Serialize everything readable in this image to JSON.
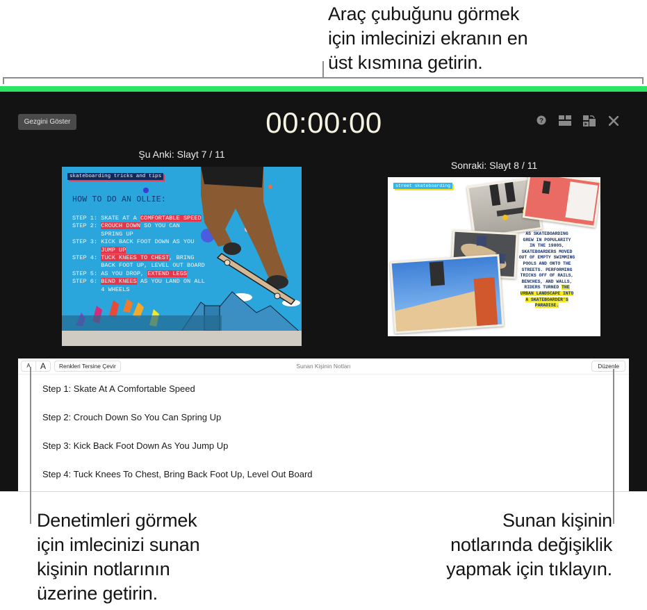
{
  "callouts": {
    "top": "Araç çubuğunu görmek\niçin imlecinizi ekranın en\nüst kısmına getirin.",
    "left": "Denetimleri görmek\niçin imlecinizi sunan\nkişinin notlarının\nüzerine getirin.",
    "right": "Sunan kişinin\nnotlarında değişiklik\nyapmak için tıklayın."
  },
  "presenter": {
    "accent_color": "#2ce564",
    "show_navigator_label": "Gezgini Göster",
    "timer": "00:00:00",
    "toolbar_icons": [
      "help-icon",
      "layout-icon",
      "swap-displays-icon",
      "close-icon"
    ],
    "current_label": "Şu Anki: Slayt 7 / 11",
    "next_label": "Sonraki: Slayt 8 / 11"
  },
  "current_slide": {
    "title": "skateboarding tricks and tips",
    "heading": "HOW TO DO AN OLLIE:",
    "steps": [
      {
        "prefix": "STEP 1: ",
        "parts": [
          {
            "t": "SKATE AT A ",
            "hl": false
          },
          {
            "t": "COMFORTABLE SPEED",
            "hl": true
          }
        ]
      },
      {
        "prefix": "STEP 2: ",
        "parts": [
          {
            "t": "CROUCH DOWN",
            "hl": true
          },
          {
            "t": " SO YOU CAN",
            "hl": false
          }
        ]
      },
      {
        "prefix": "        ",
        "parts": [
          {
            "t": "SPRING UP",
            "hl": false
          }
        ]
      },
      {
        "prefix": "STEP 3: ",
        "parts": [
          {
            "t": "KICK BACK FOOT DOWN AS YOU",
            "hl": false
          }
        ]
      },
      {
        "prefix": "        ",
        "parts": [
          {
            "t": "JUMP UP",
            "hl": true
          }
        ]
      },
      {
        "prefix": "STEP 4: ",
        "parts": [
          {
            "t": "TUCK KNEES TO CHEST",
            "hl": true
          },
          {
            "t": ", BRING",
            "hl": false
          }
        ]
      },
      {
        "prefix": "        ",
        "parts": [
          {
            "t": "BACK FOOT UP, LEVEL OUT BOARD",
            "hl": false
          }
        ]
      },
      {
        "prefix": "STEP 5: ",
        "parts": [
          {
            "t": "AS YOU DROP, ",
            "hl": false
          },
          {
            "t": "EXTEND LEGS",
            "hl": true
          }
        ]
      },
      {
        "prefix": "STEP 6: ",
        "parts": [
          {
            "t": "BEND KNEES",
            "hl": true
          },
          {
            "t": " AS YOU LAND ON ALL",
            "hl": false
          }
        ]
      },
      {
        "prefix": "        ",
        "parts": [
          {
            "t": "4 WHEELS",
            "hl": false
          }
        ]
      }
    ]
  },
  "next_slide": {
    "title": "street skateboarding",
    "text_plain": "AS SKATEBOARDING GROWN IN POPULARITY IN THE 1980S, SKATEBOARDERS MOVED OUT OF EMPTY SWIMMING POOLS AND ONTO THE STREETS. PERFORMING TRICKS OFF OF RAILS, BENCHES, AND WALLS, RIDERS TURNED",
    "text_lines": [
      "AS SKATEBOARDING",
      "GREW IN POPULARITY",
      "IN THE 1980S,",
      "SKATEBOARDERS MOVED",
      "OUT OF EMPTY SWIMMING",
      "POOLS AND ONTO THE",
      "STREETS. PERFORMING",
      "TRICKS OFF OF RAILS,",
      "BENCHES, AND WALLS,"
    ],
    "riders_line_plain": "RIDERS TURNED ",
    "riders_line_hl": "THE",
    "hl_lines": [
      "URBAN LANDSCAPE INTO",
      "A SKATEBOARDER'S",
      "PARADISE."
    ]
  },
  "notes": {
    "font_small_label": "A",
    "font_large_label": "A",
    "invert_colors_label": "Renkleri Tersine Çevir",
    "title": "Sunan Kişinin Notları",
    "edit_label": "Düzenle",
    "lines": [
      "Step 1: Skate At A Comfortable Speed",
      "Step 2: Crouch Down So You Can Spring Up",
      "Step 3: Kick Back Foot Down As You Jump Up",
      "Step 4: Tuck Knees To Chest, Bring Back Foot Up, Level Out Board"
    ]
  }
}
